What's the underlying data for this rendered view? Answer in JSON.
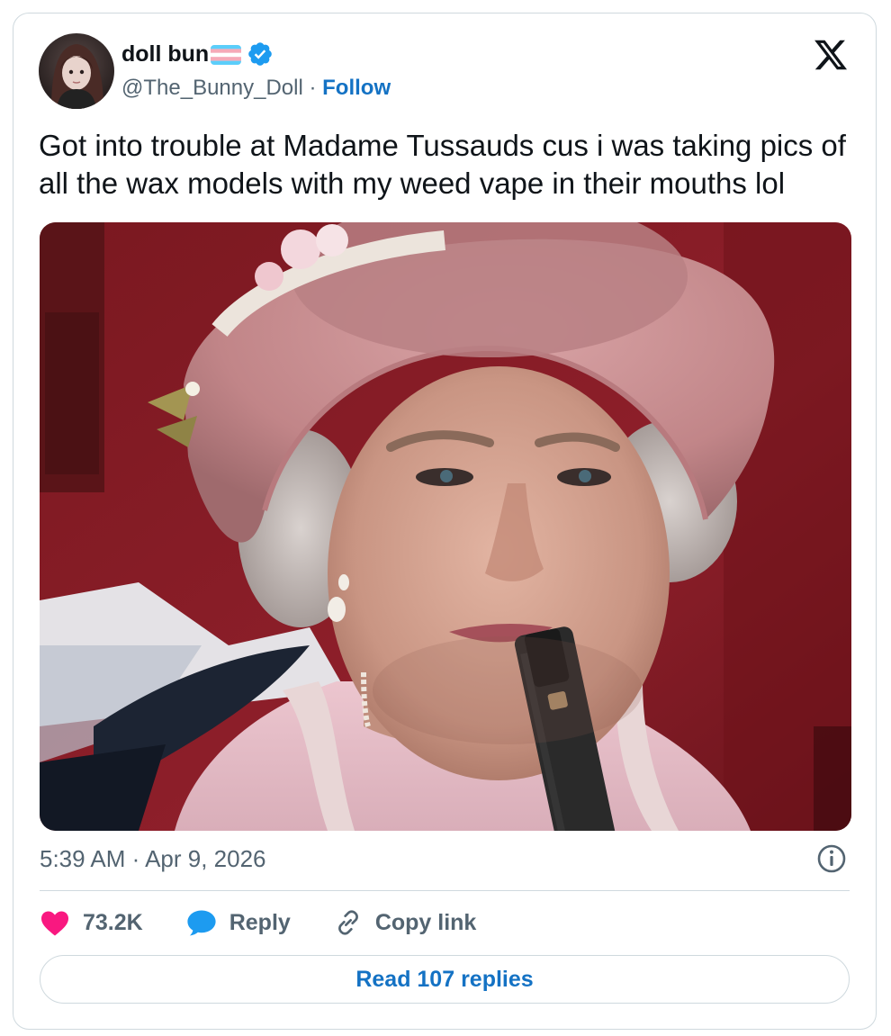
{
  "author": {
    "display_name": "doll bun",
    "flag_icon": "transgender-flag-icon",
    "verified_icon": "verified-badge-icon",
    "handle": "@The_Bunny_Doll",
    "separator": " · ",
    "follow_label": "Follow"
  },
  "brand": {
    "logo_icon": "x-logo-icon"
  },
  "tweet": {
    "text": "Got into trouble at Madame Tussauds cus i was taking pics of all the wax models with my weed vape in their mouths lol",
    "timestamp": "5:39 AM · Apr 9, 2026"
  },
  "actions": {
    "like_icon": "heart-icon",
    "like_count": "73.2K",
    "reply_icon": "speech-bubble-icon",
    "reply_label": "Reply",
    "copy_icon": "link-icon",
    "copy_label": "Copy link"
  },
  "footer": {
    "read_replies_label": "Read 107 replies"
  },
  "colors": {
    "accent": "#1472c4",
    "like": "#f91880",
    "verified": "#1d9bf0",
    "muted_text": "#536471",
    "border": "#cfd9de"
  }
}
